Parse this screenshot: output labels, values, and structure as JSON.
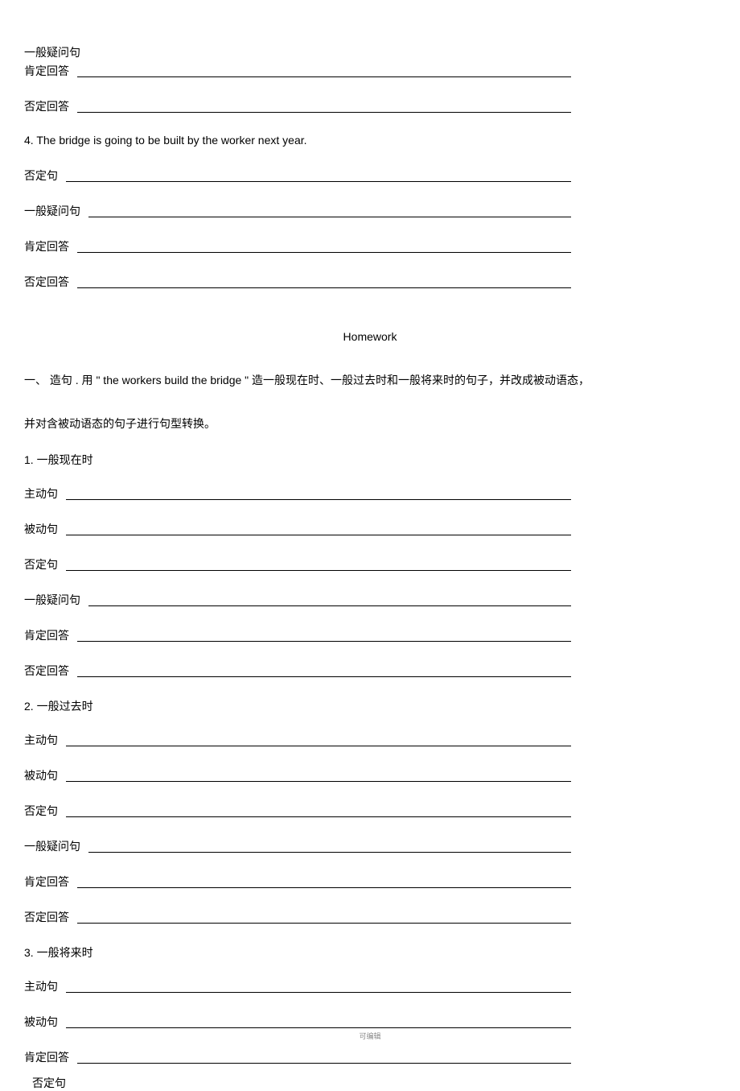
{
  "topSection": {
    "yibanYiwen": "一般疑问句",
    "kendingHuida": "肯定回答",
    "foudingHuida": "否定回答",
    "item4": "4.  The bridge is going to be built by the worker next year.",
    "foudingJu": "否定句"
  },
  "homework": {
    "title": "Homework",
    "instruction": "一、 造句  . 用 \" the workers build the bridge \" 造一般现在时、一般过去时和一般将来时的句子，并改成被动语态，",
    "instructionLine2": "并对含被动语态的句子进行句型转换。"
  },
  "sections": {
    "s1": {
      "heading": "1.  一般现在时",
      "zhudongJu": "主动句",
      "beidongJu": "被动句",
      "foudingJu": "否定句",
      "yibanYiwen": "一般疑问句",
      "kendingHuida": "肯定回答",
      "foudingHuida": "否定回答"
    },
    "s2": {
      "heading": "2.  一般过去时",
      "zhudongJu": "主动句",
      "beidongJu": "被动句",
      "foudingJu": "否定句",
      "yibanYiwen": "一般疑问句",
      "kendingHuida": "肯定回答",
      "foudingHuida": "否定回答"
    },
    "s3": {
      "heading": "3.  一般将来时",
      "zhudongJu": "主动句",
      "beidongJu": "被动句",
      "kendingHuida": "肯定回答",
      "foudingJu": "否定句"
    }
  },
  "footer": "可编辑"
}
